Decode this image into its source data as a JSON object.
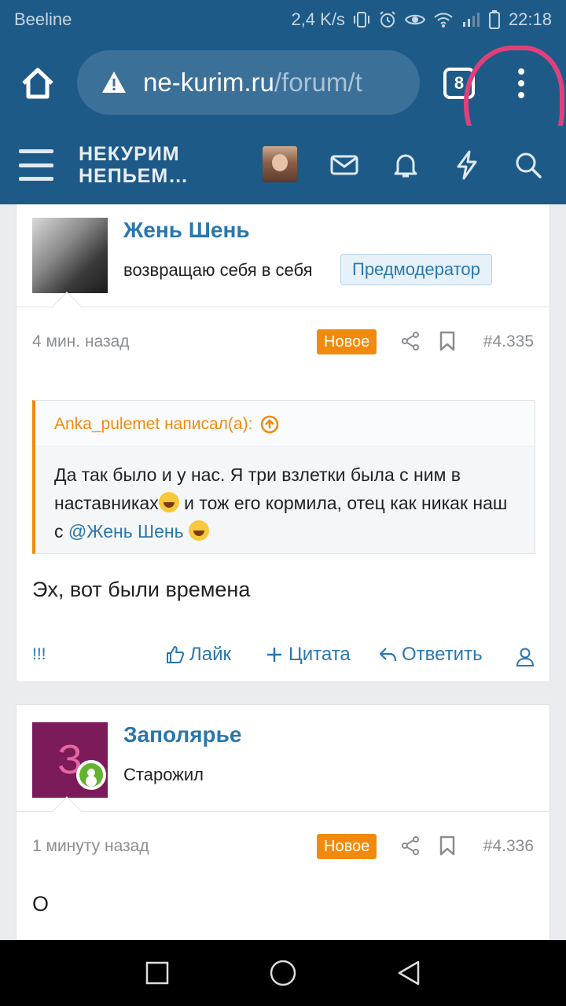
{
  "status_bar": {
    "carrier": "Beeline",
    "speed": "2,4 K/s",
    "time": "22:18"
  },
  "browser": {
    "url_domain": "ne-kurim.ru",
    "url_path": "/forum/t",
    "tab_count": "8"
  },
  "site": {
    "logo_line1": "НЕКУРИМ",
    "logo_line2": "НЕПЬЕМ…"
  },
  "posts": [
    {
      "author": "Жень Шень",
      "user_title": "возвращаю себя в себя",
      "badge": "Предмодератор",
      "time": "4 мин. назад",
      "new_label": "Новое",
      "number": "#4.335",
      "quote": {
        "header": "Anka_pulemet написал(а):",
        "text_part1": "Да так было и у нас. Я три взлетки была с ним в наставниках",
        "text_part2": " и тож его кормила, отец как никак наш с ",
        "mention": "@Жень Шень"
      },
      "message": "Эх, вот были времена",
      "actions": {
        "report": "!!!",
        "like": "Лайк",
        "quote": "Цитата",
        "reply": "Ответить"
      }
    },
    {
      "author": "Заполярье",
      "avatar_letter": "З",
      "user_title": "Старожил",
      "time": "1 минуту назад",
      "new_label": "Новое",
      "number": "#4.336",
      "message": "О"
    }
  ],
  "colors": {
    "header_bg": "#1d5a88",
    "link": "#2a77ad",
    "new_badge": "#f28a0d",
    "highlight": "#e0407a"
  }
}
